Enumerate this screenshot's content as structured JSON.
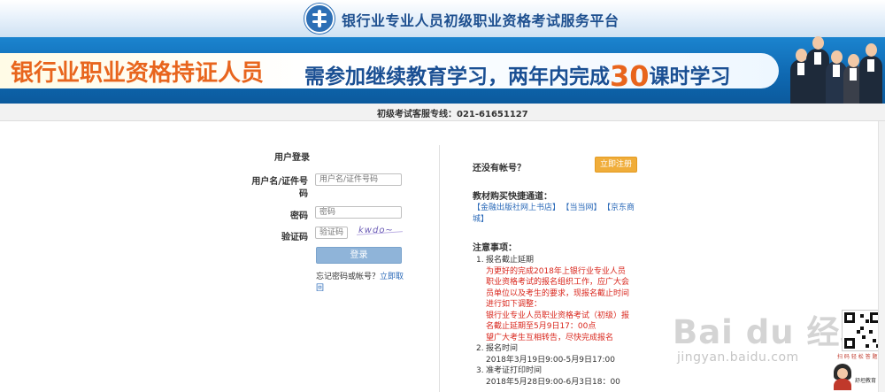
{
  "header": {
    "site_title": "银行业专业人员初级职业资格考试服务平台"
  },
  "banner": {
    "slogan_left": "银行业职业资格持证人员",
    "slogan_right_a": "需参加继续教育学习，两年内完成",
    "slogan_right_hours": "30",
    "slogan_right_b": "课时学习"
  },
  "hotline": {
    "text": "初级考试客服专线：021-61651127"
  },
  "login": {
    "title": "用户登录",
    "username_label": "用户名/证件号码",
    "username_placeholder": "用户名/证件号码",
    "password_label": "密码",
    "password_placeholder": "密码",
    "captcha_label": "验证码",
    "captcha_placeholder": "验证码",
    "captcha_text": "kwdo~",
    "login_button": "登录",
    "forgot_prefix": "忘记密码或帐号？",
    "forgot_link": "立即取回"
  },
  "register": {
    "prompt": "还没有帐号？",
    "button": "立即注册"
  },
  "books": {
    "title": "教材购买快捷通道：",
    "links": [
      "【金融出版社网上书店】",
      "【当当网】",
      "【京东商城】"
    ]
  },
  "notice": {
    "title": "注意事项：",
    "items": [
      {
        "num": "1.",
        "label": "报名截止延期",
        "red_lines": [
          "为更好的完成2018年上银行业专业人员职业资格考试的报名组织工作，应广大会员单位以及考生的要求，现报名截止时间进行如下调整：",
          "银行业专业人员职业资格考试（初级）报名截止延期至5月9日17：00点",
          "望广大考生互相转告，尽快完成报名"
        ]
      },
      {
        "num": "2.",
        "label": "报名时间",
        "date": "2018年3月19日9:00-5月9日17:00"
      },
      {
        "num": "3.",
        "label": "准考证打印时间",
        "date": "2018年5月28日9:00-6月3日18：00"
      }
    ]
  },
  "watermark": {
    "brand": "Bai du 经验",
    "site": "jingyan.baidu.com",
    "qr_caption": "扫 码 轻 松 答 题",
    "author": "舒坦教育"
  },
  "colors": {
    "banner_blue": "#0f69b2",
    "accent_orange": "#e8651d",
    "register_orange": "#f0ad3a",
    "link_blue": "#2a69b8",
    "notice_red": "#d9261c",
    "login_button": "#8fb4d9"
  }
}
